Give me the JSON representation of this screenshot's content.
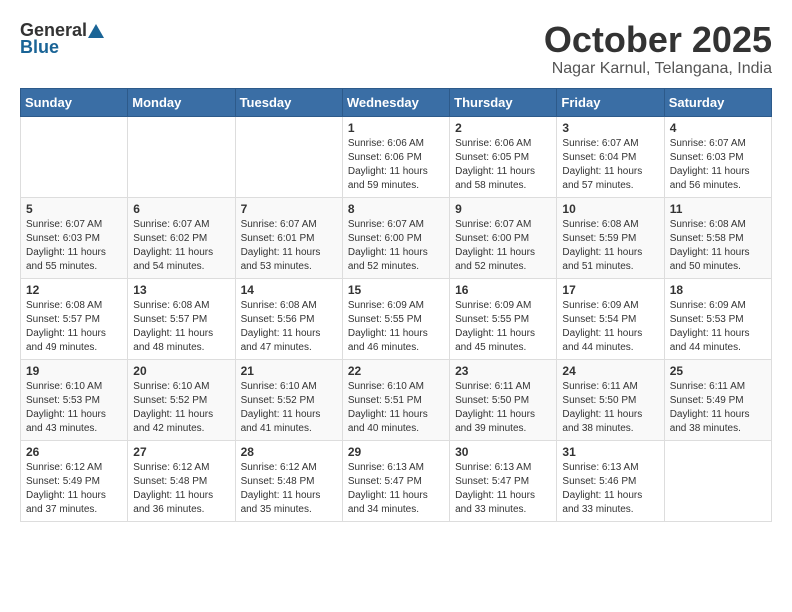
{
  "header": {
    "logo_general": "General",
    "logo_blue": "Blue",
    "month_title": "October 2025",
    "location": "Nagar Karnul, Telangana, India"
  },
  "weekdays": [
    "Sunday",
    "Monday",
    "Tuesday",
    "Wednesday",
    "Thursday",
    "Friday",
    "Saturday"
  ],
  "weeks": [
    [
      {
        "day": "",
        "text": ""
      },
      {
        "day": "",
        "text": ""
      },
      {
        "day": "",
        "text": ""
      },
      {
        "day": "1",
        "text": "Sunrise: 6:06 AM\nSunset: 6:06 PM\nDaylight: 11 hours\nand 59 minutes."
      },
      {
        "day": "2",
        "text": "Sunrise: 6:06 AM\nSunset: 6:05 PM\nDaylight: 11 hours\nand 58 minutes."
      },
      {
        "day": "3",
        "text": "Sunrise: 6:07 AM\nSunset: 6:04 PM\nDaylight: 11 hours\nand 57 minutes."
      },
      {
        "day": "4",
        "text": "Sunrise: 6:07 AM\nSunset: 6:03 PM\nDaylight: 11 hours\nand 56 minutes."
      }
    ],
    [
      {
        "day": "5",
        "text": "Sunrise: 6:07 AM\nSunset: 6:03 PM\nDaylight: 11 hours\nand 55 minutes."
      },
      {
        "day": "6",
        "text": "Sunrise: 6:07 AM\nSunset: 6:02 PM\nDaylight: 11 hours\nand 54 minutes."
      },
      {
        "day": "7",
        "text": "Sunrise: 6:07 AM\nSunset: 6:01 PM\nDaylight: 11 hours\nand 53 minutes."
      },
      {
        "day": "8",
        "text": "Sunrise: 6:07 AM\nSunset: 6:00 PM\nDaylight: 11 hours\nand 52 minutes."
      },
      {
        "day": "9",
        "text": "Sunrise: 6:07 AM\nSunset: 6:00 PM\nDaylight: 11 hours\nand 52 minutes."
      },
      {
        "day": "10",
        "text": "Sunrise: 6:08 AM\nSunset: 5:59 PM\nDaylight: 11 hours\nand 51 minutes."
      },
      {
        "day": "11",
        "text": "Sunrise: 6:08 AM\nSunset: 5:58 PM\nDaylight: 11 hours\nand 50 minutes."
      }
    ],
    [
      {
        "day": "12",
        "text": "Sunrise: 6:08 AM\nSunset: 5:57 PM\nDaylight: 11 hours\nand 49 minutes."
      },
      {
        "day": "13",
        "text": "Sunrise: 6:08 AM\nSunset: 5:57 PM\nDaylight: 11 hours\nand 48 minutes."
      },
      {
        "day": "14",
        "text": "Sunrise: 6:08 AM\nSunset: 5:56 PM\nDaylight: 11 hours\nand 47 minutes."
      },
      {
        "day": "15",
        "text": "Sunrise: 6:09 AM\nSunset: 5:55 PM\nDaylight: 11 hours\nand 46 minutes."
      },
      {
        "day": "16",
        "text": "Sunrise: 6:09 AM\nSunset: 5:55 PM\nDaylight: 11 hours\nand 45 minutes."
      },
      {
        "day": "17",
        "text": "Sunrise: 6:09 AM\nSunset: 5:54 PM\nDaylight: 11 hours\nand 44 minutes."
      },
      {
        "day": "18",
        "text": "Sunrise: 6:09 AM\nSunset: 5:53 PM\nDaylight: 11 hours\nand 44 minutes."
      }
    ],
    [
      {
        "day": "19",
        "text": "Sunrise: 6:10 AM\nSunset: 5:53 PM\nDaylight: 11 hours\nand 43 minutes."
      },
      {
        "day": "20",
        "text": "Sunrise: 6:10 AM\nSunset: 5:52 PM\nDaylight: 11 hours\nand 42 minutes."
      },
      {
        "day": "21",
        "text": "Sunrise: 6:10 AM\nSunset: 5:52 PM\nDaylight: 11 hours\nand 41 minutes."
      },
      {
        "day": "22",
        "text": "Sunrise: 6:10 AM\nSunset: 5:51 PM\nDaylight: 11 hours\nand 40 minutes."
      },
      {
        "day": "23",
        "text": "Sunrise: 6:11 AM\nSunset: 5:50 PM\nDaylight: 11 hours\nand 39 minutes."
      },
      {
        "day": "24",
        "text": "Sunrise: 6:11 AM\nSunset: 5:50 PM\nDaylight: 11 hours\nand 38 minutes."
      },
      {
        "day": "25",
        "text": "Sunrise: 6:11 AM\nSunset: 5:49 PM\nDaylight: 11 hours\nand 38 minutes."
      }
    ],
    [
      {
        "day": "26",
        "text": "Sunrise: 6:12 AM\nSunset: 5:49 PM\nDaylight: 11 hours\nand 37 minutes."
      },
      {
        "day": "27",
        "text": "Sunrise: 6:12 AM\nSunset: 5:48 PM\nDaylight: 11 hours\nand 36 minutes."
      },
      {
        "day": "28",
        "text": "Sunrise: 6:12 AM\nSunset: 5:48 PM\nDaylight: 11 hours\nand 35 minutes."
      },
      {
        "day": "29",
        "text": "Sunrise: 6:13 AM\nSunset: 5:47 PM\nDaylight: 11 hours\nand 34 minutes."
      },
      {
        "day": "30",
        "text": "Sunrise: 6:13 AM\nSunset: 5:47 PM\nDaylight: 11 hours\nand 33 minutes."
      },
      {
        "day": "31",
        "text": "Sunrise: 6:13 AM\nSunset: 5:46 PM\nDaylight: 11 hours\nand 33 minutes."
      },
      {
        "day": "",
        "text": ""
      }
    ]
  ]
}
